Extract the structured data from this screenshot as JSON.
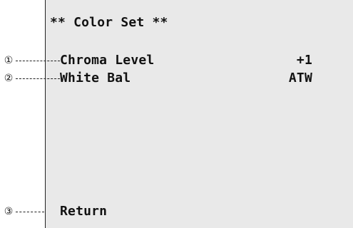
{
  "menu": {
    "title": "** Color Set **",
    "items": [
      {
        "label": "Chroma Level",
        "value": "+1"
      },
      {
        "label": "White Bal",
        "value": "ATW"
      }
    ],
    "return_label": "Return"
  },
  "callouts": [
    "①",
    "②",
    "③"
  ]
}
